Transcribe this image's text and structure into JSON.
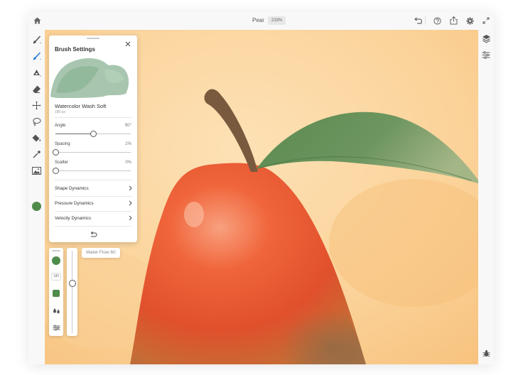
{
  "app": {
    "document_name": "Pear",
    "zoom_level": "233%"
  },
  "top_toolbar": {
    "icons": [
      "home-icon",
      "undo-icon",
      "help-icon",
      "share-icon",
      "settings-icon",
      "fullscreen-icon"
    ]
  },
  "left_toolbar": {
    "tools": [
      "pixel-brush-icon",
      "live-brush-icon",
      "vector-brush-icon",
      "eraser-icon",
      "transform-icon",
      "lasso-icon",
      "fill-icon",
      "eyedropper-icon",
      "image-icon"
    ],
    "current_color": "#4f8b4a"
  },
  "right_toolbar": {
    "icons": [
      "layers-icon",
      "layer-properties-icon",
      "bug-icon"
    ]
  },
  "brush_settings": {
    "title": "Brush Settings",
    "brush_name": "Watercolor Wash Soft",
    "brush_size": "180 px",
    "sliders": [
      {
        "label": "Angle",
        "value": "90°",
        "fraction": 0.5
      },
      {
        "label": "Spacing",
        "value": "2%",
        "fraction": 0.0
      },
      {
        "label": "Scatter",
        "value": "0%",
        "fraction": 0.0
      }
    ],
    "dynamics": [
      {
        "label": "Shape Dynamics"
      },
      {
        "label": "Pressure Dynamics"
      },
      {
        "label": "Velocity Dynamics"
      }
    ]
  },
  "brush_mini_panel": {
    "size_value": "180",
    "color": "#4f8b4a"
  },
  "flow": {
    "tooltip": "Water Flow 60",
    "level": 0.6
  }
}
